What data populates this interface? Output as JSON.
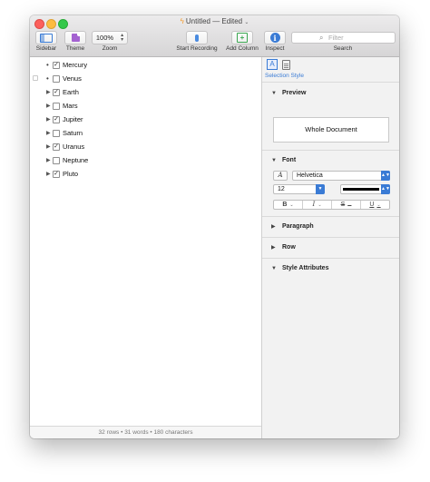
{
  "window": {
    "title": "Untitled",
    "title_suffix": "— Edited",
    "title_chevron": "⌄",
    "doc_icon": "document-icon"
  },
  "toolbar": {
    "sidebar_label": "Sidebar",
    "theme_label": "Theme",
    "zoom_value": "100%",
    "zoom_label": "Zoom",
    "record_label": "Start Recording",
    "add_column_label": "Add Column",
    "inspect_label": "Inspect",
    "search_placeholder": "Filter",
    "search_label": "Search"
  },
  "outline": {
    "rows": [
      {
        "name": "Mercury",
        "checked": true,
        "marker": "bullet"
      },
      {
        "name": "Venus",
        "checked": false,
        "marker": "bullet"
      },
      {
        "name": "Earth",
        "checked": true,
        "marker": "triangle"
      },
      {
        "name": "Mars",
        "checked": false,
        "marker": "triangle"
      },
      {
        "name": "Jupiter",
        "checked": true,
        "marker": "triangle"
      },
      {
        "name": "Saturn",
        "checked": false,
        "marker": "triangle"
      },
      {
        "name": "Uranus",
        "checked": true,
        "marker": "triangle"
      },
      {
        "name": "Neptune",
        "checked": false,
        "marker": "triangle"
      },
      {
        "name": "Pluto",
        "checked": true,
        "marker": "triangle"
      }
    ]
  },
  "status": {
    "text": "32 rows • 31 words • 180 characters"
  },
  "inspector": {
    "selection_style": "Selection Style",
    "preview_title": "Preview",
    "preview_text": "Whole Document",
    "font_title": "Font",
    "font_family": "Helvetica",
    "font_size": "12",
    "paragraph_title": "Paragraph",
    "row_title": "Row",
    "style_attributes_title": "Style Attributes",
    "bold_glyph": "B",
    "italic_glyph": "I",
    "strike_glyph": "S",
    "underline_glyph": "U",
    "text_color": "#000000"
  },
  "colors": {
    "accent": "#3a7bd5",
    "close": "#fc605c",
    "minimize": "#fdbc40",
    "zoom": "#34c84a"
  }
}
